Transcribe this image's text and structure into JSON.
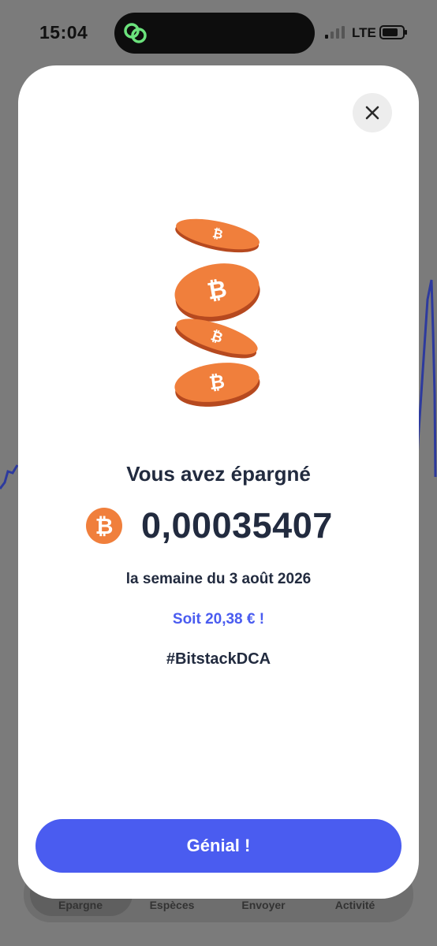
{
  "status_bar": {
    "time": "15:04",
    "network": "LTE"
  },
  "background_tabs": [
    "Epargne",
    "Espèces",
    "Envoyer",
    "Activité"
  ],
  "modal": {
    "headline": "Vous avez épargné",
    "amount": "0,00035407",
    "period": "la semaine du 3 août 2026",
    "fiat_value": "Soit 20,38 € !",
    "hashtag": "#BitstackDCA",
    "cta_label": "Génial !"
  },
  "colors": {
    "accent": "#4a5cf0",
    "bitcoin_orange": "#f07f3c",
    "text_dark": "#222b3f",
    "overlay": "#7b7b7b"
  },
  "icons": {
    "close": "close-icon",
    "bitcoin": "bitcoin-icon",
    "island_app": "link-rings-icon"
  }
}
